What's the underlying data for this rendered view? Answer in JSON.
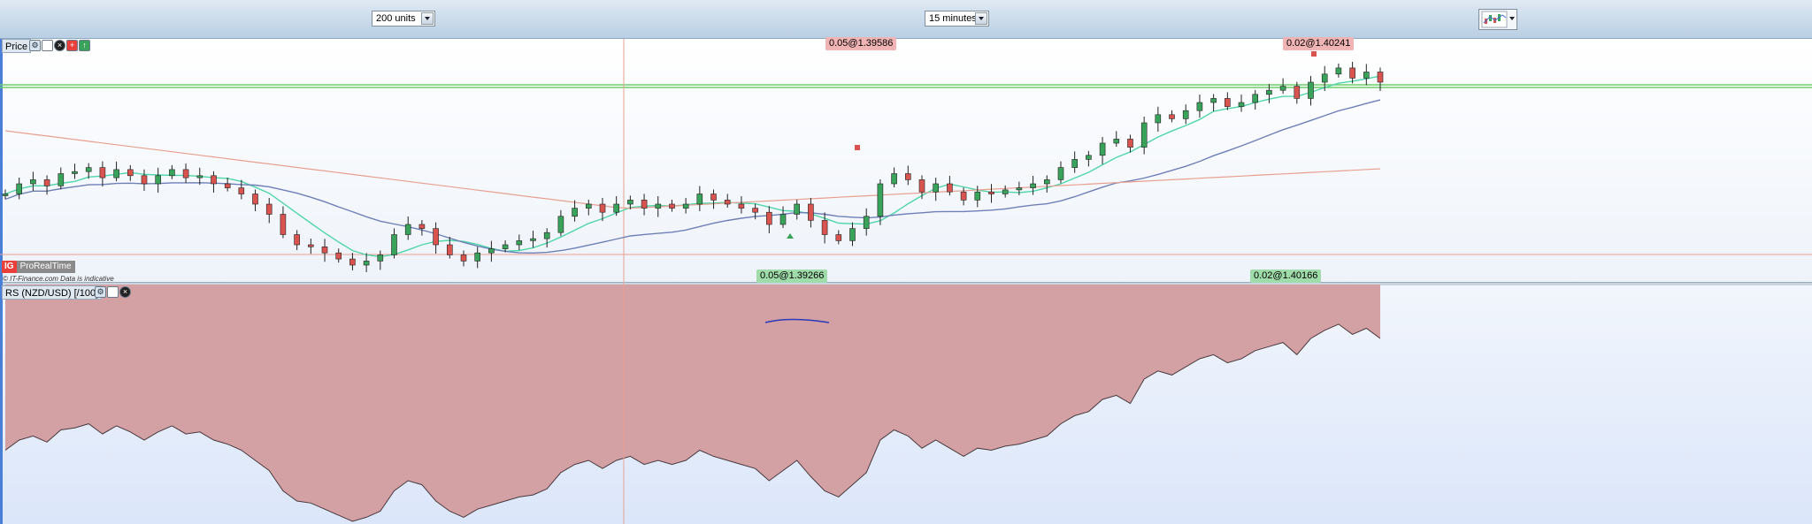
{
  "toolbar": {
    "units_select": {
      "value": "200 units"
    },
    "timeframe_select": {
      "value": "15 minutes"
    },
    "chart_type_icon": "candlestick-chart-icon"
  },
  "price_pane": {
    "label": "Price",
    "tool_icons": [
      "wrench-icon",
      "window-icon",
      "close-icon",
      "add-icon",
      "arrow-up-icon"
    ],
    "annotations": {
      "high_left": "0.05@1.39586",
      "high_right": "0.02@1.40241",
      "low_left": "0.05@1.39266",
      "low_right": "0.02@1.40166"
    },
    "logo": {
      "ig": "IG",
      "prt": "ProRealTime"
    },
    "copyright": "© IT-Finance.com Data is indicative"
  },
  "indicator_pane": {
    "label": "RS (NZD/USD) [/100]",
    "tool_icons": [
      "wrench-icon",
      "window-icon",
      "close-icon"
    ]
  },
  "colors": {
    "bull": "#3aa35b",
    "bear": "#d9534f",
    "ma_fast": "#4fd6a8",
    "ma_mid": "#6f7fb8",
    "ma_slow": "#e8a090",
    "area_fill": "#d3a0a4",
    "crosshair": "#e9a090"
  },
  "chart_data": {
    "type": "line",
    "series": [
      {
        "values": [
          0.35,
          0.4,
          0.42,
          0.39,
          0.45,
          0.46,
          0.48,
          0.43,
          0.47,
          0.44,
          0.4,
          0.44,
          0.47,
          0.43,
          0.44,
          0.4,
          0.38,
          0.35,
          0.3,
          0.25,
          0.15,
          0.1,
          0.09,
          0.06,
          0.03,
          0.0,
          0.02,
          0.05,
          0.15,
          0.2,
          0.18,
          0.1,
          0.05,
          0.02,
          0.06,
          0.08,
          0.1,
          0.12,
          0.13,
          0.16,
          0.24,
          0.28,
          0.3,
          0.26,
          0.3,
          0.32,
          0.28,
          0.3,
          0.28,
          0.3,
          0.35,
          0.32,
          0.3,
          0.28,
          0.26,
          0.2,
          0.25,
          0.3,
          0.22,
          0.15,
          0.12,
          0.18,
          0.24,
          0.4,
          0.45,
          0.42,
          0.36,
          0.4,
          0.36,
          0.32,
          0.36,
          0.35,
          0.37,
          0.38,
          0.4,
          0.42,
          0.48,
          0.52,
          0.54,
          0.6,
          0.62,
          0.58,
          0.7,
          0.74,
          0.72,
          0.76,
          0.8,
          0.82,
          0.78,
          0.8,
          0.84,
          0.86,
          0.88,
          0.82,
          0.9,
          0.94,
          0.97,
          0.92,
          0.95,
          0.9
        ]
      }
    ]
  }
}
